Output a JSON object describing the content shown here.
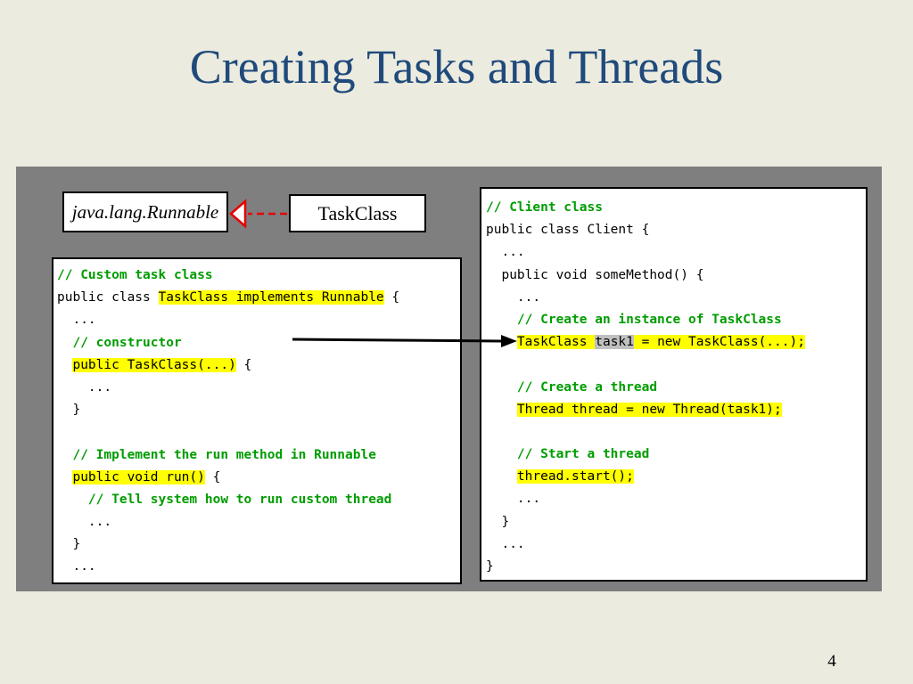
{
  "slide": {
    "title": "Creating Tasks and Threads",
    "page_number": "4"
  },
  "uml": {
    "interface_label": "java.lang.Runnable",
    "class_label": "TaskClass"
  },
  "task_code": {
    "l1": "// Custom task class",
    "l2a": "public class ",
    "l2b": "TaskClass implements Runnable",
    "l2c": " {",
    "l3": "  ...",
    "l4a": "  ",
    "l4b": "// constructor",
    "l5a": "  ",
    "l5b": "public TaskClass(...)",
    "l5c": " {",
    "l6": "    ...",
    "l7": "  }",
    "l9a": "  ",
    "l9b": "// Implement the run method in Runnable",
    "l10a": "  ",
    "l10b": "public void run()",
    "l10c": " {",
    "l11a": "    ",
    "l11b": "// Tell system how to run custom thread",
    "l12": "    ...",
    "l13": "  }",
    "l14": "  ...",
    "l15": "}"
  },
  "client_code": {
    "l1": "// Client class",
    "l2": "public class Client {",
    "l3": "  ...",
    "l4": "  public void someMethod() {",
    "l5": "    ...",
    "l6a": "    ",
    "l6b": "// Create an instance of TaskClass",
    "l7a": "    ",
    "l7b": "TaskClass ",
    "l7c": "task1",
    "l7d": " = new TaskClass(...);",
    "l9a": "    ",
    "l9b": "// Create a thread",
    "l10a": "    ",
    "l10b": "Thread thread = new Thread(task1);",
    "l12a": "    ",
    "l12b": "// Start a thread",
    "l13a": "    ",
    "l13b": "thread.start();",
    "l14": "    ...",
    "l15": "  }",
    "l16": "  ...",
    "l17": "}"
  },
  "colors": {
    "title": "#1f4a7a",
    "comment": "#009c00",
    "highlight": "#ffff00",
    "variable_highlight": "#c0c0c0",
    "realization_arrow": "#e60000",
    "background": "#ecebe0",
    "panel": "#7f7f7f"
  }
}
